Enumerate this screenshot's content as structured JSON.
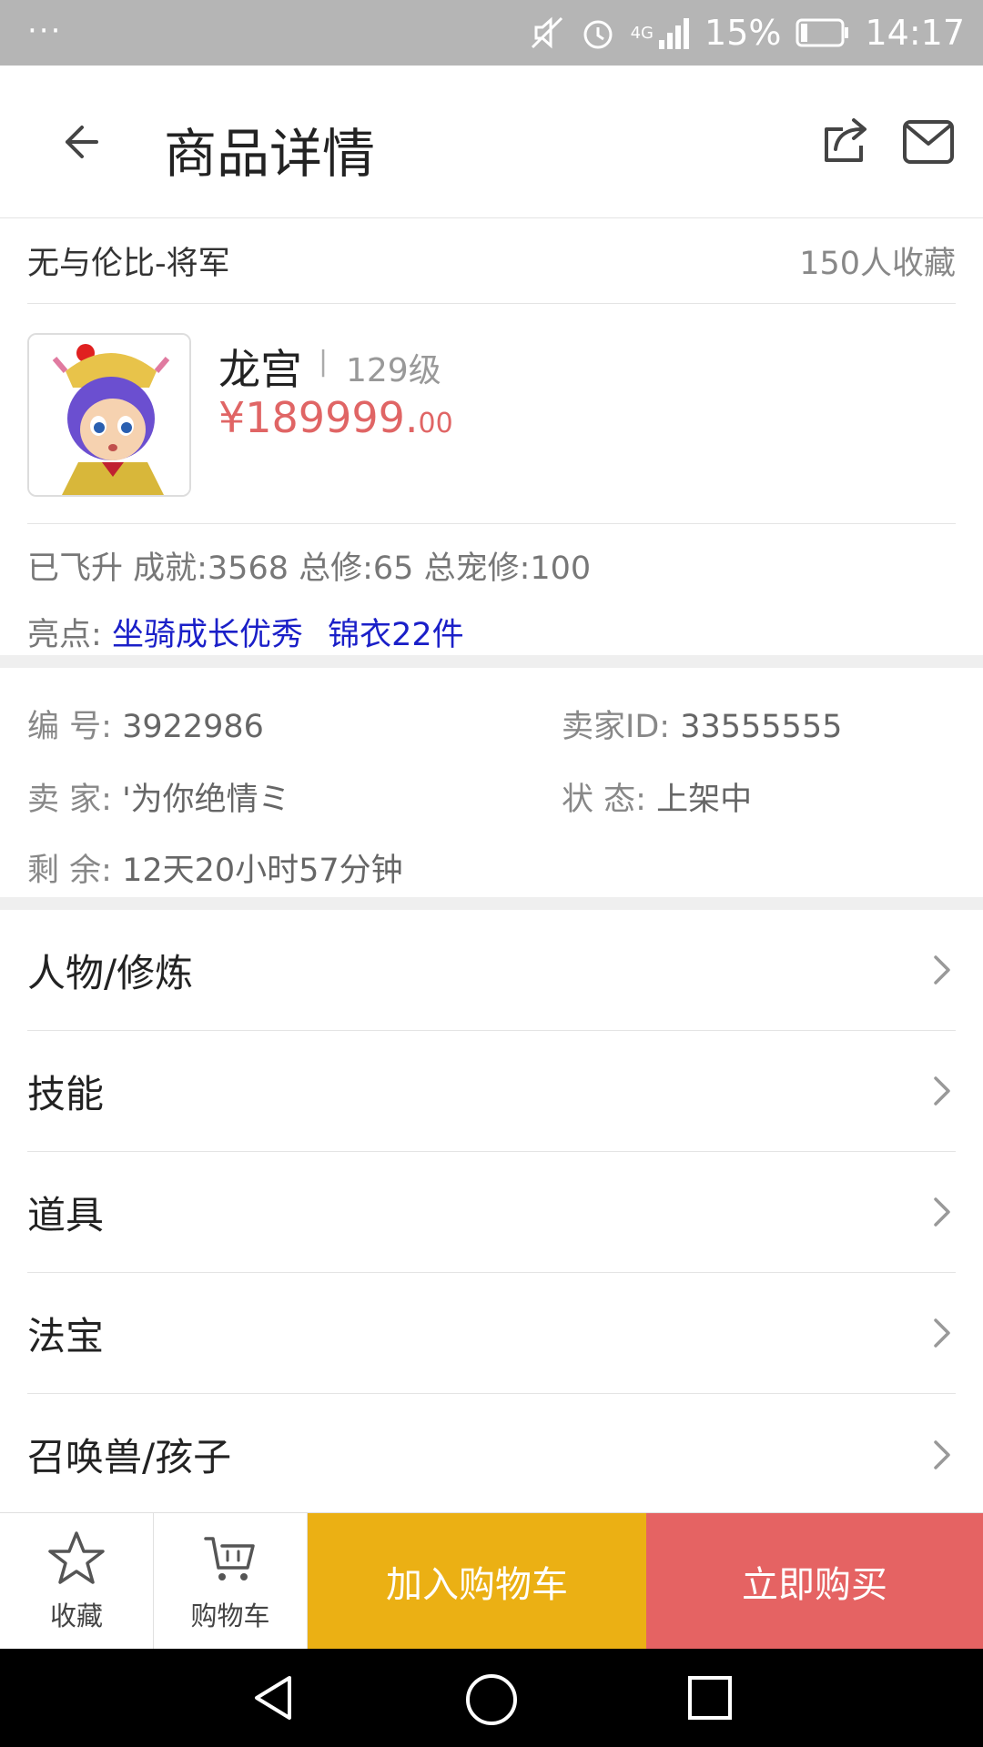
{
  "status_bar": {
    "more": "···",
    "network": "4G",
    "battery": "15%",
    "time": "14:17"
  },
  "header": {
    "title": "商品详情"
  },
  "product": {
    "name": "无与伦比-将军",
    "favorites": "150人收藏",
    "sect": "龙宫",
    "separator": "|",
    "level": "129级",
    "price_main": "¥189999.",
    "price_cents": "00",
    "stats": "已飞升 成就:3568 总修:65 总宠修:100",
    "highlights_label": "亮点:",
    "highlights": [
      "坐骑成长优秀",
      "锦衣22件"
    ]
  },
  "info": {
    "id_label": "编  号:",
    "id_value": "3922986",
    "seller_id_label": "卖家ID:",
    "seller_id_value": "33555555",
    "seller_label": "卖  家:",
    "seller_value": "'为你绝情ミ",
    "status_label": "状  态:",
    "status_value": "上架中",
    "remaining_label": "剩  余:",
    "remaining_value": "12天20小时57分钟"
  },
  "menu": {
    "items": [
      {
        "label": "人物/修炼"
      },
      {
        "label": "技能"
      },
      {
        "label": "道具"
      },
      {
        "label": "法宝"
      },
      {
        "label": "召唤兽/孩子"
      }
    ]
  },
  "actions": {
    "favorite_label": "收藏",
    "cart_label": "购物车",
    "add_to_cart": "加入购物车",
    "buy_now": "立即购买"
  },
  "colors": {
    "price": "#e06565",
    "highlight": "#1a1fc8",
    "add_cart_bg": "#ebb014",
    "buy_bg": "#e56363"
  },
  "icons": [
    "back-arrow-icon",
    "share-icon",
    "mail-icon",
    "star-icon",
    "cart-icon",
    "chevron-right-icon",
    "nav-back-icon",
    "nav-home-icon",
    "nav-recents-icon"
  ]
}
